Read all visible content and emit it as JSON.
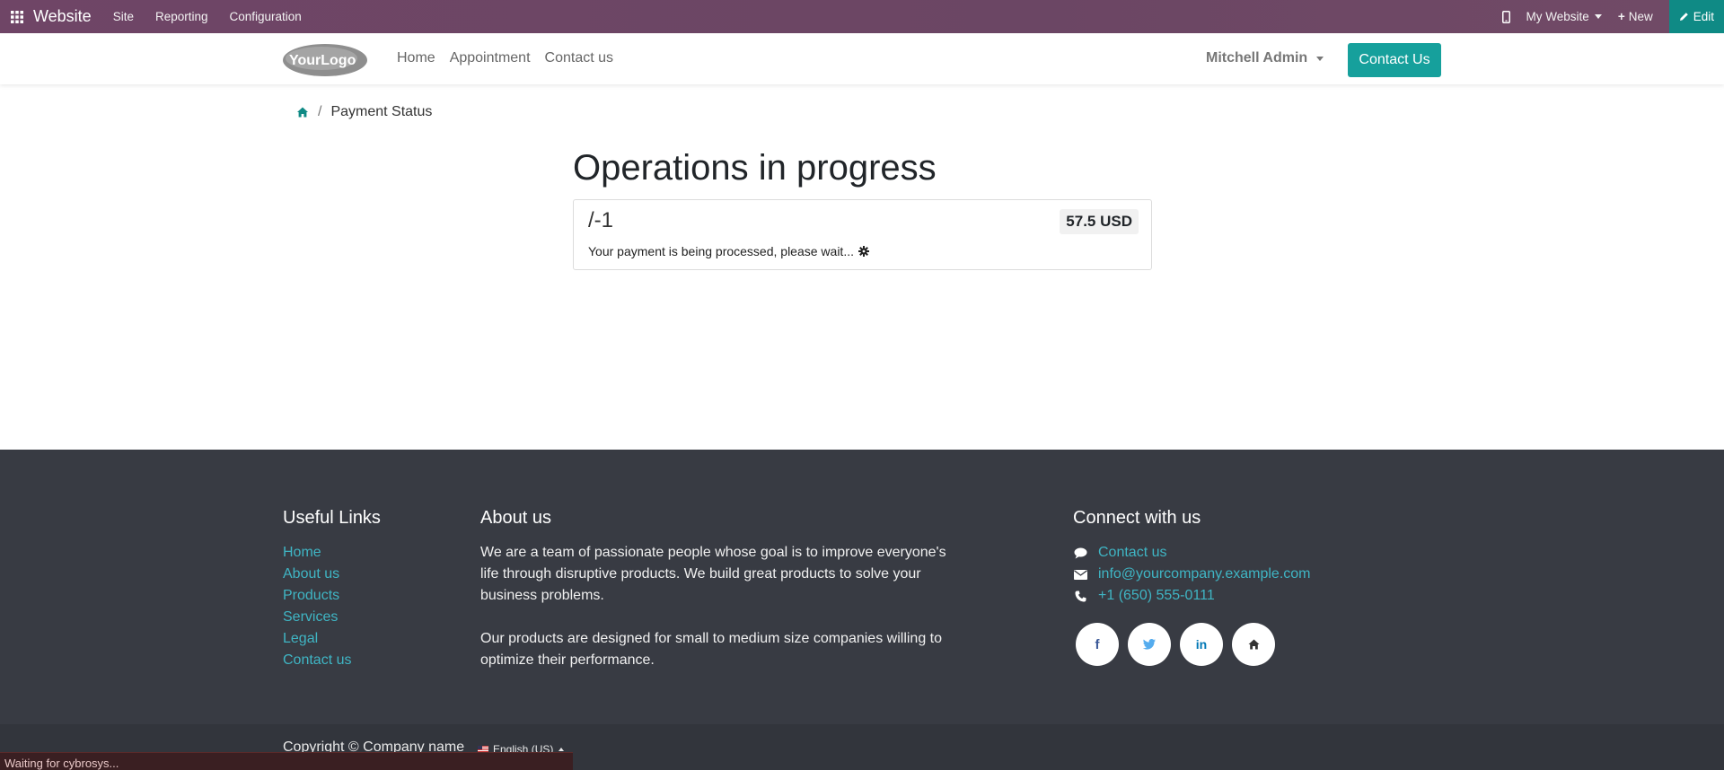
{
  "adminbar": {
    "app_name": "Website",
    "menu": [
      "Site",
      "Reporting",
      "Configuration"
    ],
    "website_selector": "My Website",
    "new_label": "New",
    "edit_label": "Edit"
  },
  "header": {
    "logo_text": "YourLogo",
    "nav": [
      "Home",
      "Appointment",
      "Contact us"
    ],
    "user_name": "Mitchell Admin",
    "contact_button": "Contact Us"
  },
  "breadcrumb": {
    "current": "Payment Status"
  },
  "main": {
    "heading": "Operations in progress",
    "reference": "/-1",
    "amount": "57.5 USD",
    "message": "Your payment is being processed, please wait..."
  },
  "footer": {
    "useful_links": {
      "title": "Useful Links",
      "items": [
        "Home",
        "About us",
        "Products",
        "Services",
        "Legal",
        "Contact us"
      ]
    },
    "about": {
      "title": "About us",
      "paragraph1": "We are a team of passionate people whose goal is to improve everyone's life through disruptive products. We build great products to solve your business problems.",
      "paragraph2": "Our products are designed for small to medium size companies willing to optimize their performance."
    },
    "connect": {
      "title": "Connect with us",
      "contact": "Contact us",
      "email": "info@yourcompany.example.com",
      "phone": "+1 (650) 555-0111",
      "social_icons": [
        "facebook-icon",
        "twitter-icon",
        "linkedin-icon",
        "home-icon"
      ]
    }
  },
  "copyright": {
    "text": "Copyright © Company name",
    "language": "English (US)"
  },
  "status_bar": {
    "text": "Waiting for cybrosys..."
  },
  "colors": {
    "admin_bar": "#6f4566",
    "edit_button": "#0f8a85",
    "primary_button": "#16a09c",
    "footer_bg": "#383b43",
    "link": "#3fb5c4"
  }
}
